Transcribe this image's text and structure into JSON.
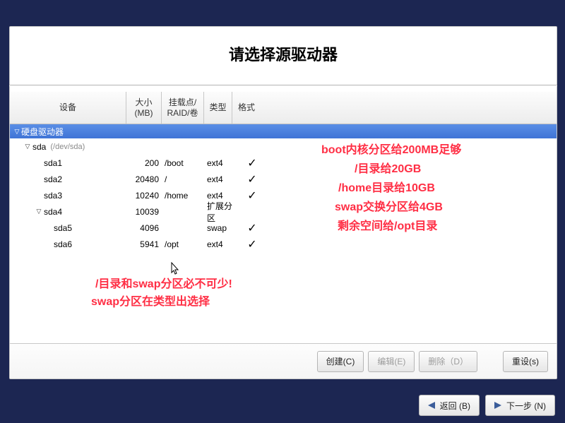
{
  "title": "请选择源驱动器",
  "headers": {
    "device": "设备",
    "size": "大小 (MB)",
    "mount": "挂载点/ RAID/卷",
    "type": "类型",
    "format": "格式"
  },
  "group_label": "硬盘驱动器",
  "disk": {
    "name": "sda",
    "path": "(/dev/sda)"
  },
  "rows": [
    {
      "indent": 48,
      "tri": "",
      "dev": "sda1",
      "size": "200",
      "mount": "/boot",
      "type": "ext4",
      "fmt": "✓"
    },
    {
      "indent": 48,
      "tri": "",
      "dev": "sda2",
      "size": "20480",
      "mount": "/",
      "type": "ext4",
      "fmt": "✓"
    },
    {
      "indent": 48,
      "tri": "",
      "dev": "sda3",
      "size": "10240",
      "mount": "/home",
      "type": "ext4",
      "fmt": "✓"
    },
    {
      "indent": 34,
      "tri": "▽",
      "dev": "sda4",
      "size": "10039",
      "mount": "",
      "type": "扩展分区",
      "fmt": ""
    },
    {
      "indent": 62,
      "tri": "",
      "dev": "sda5",
      "size": "4096",
      "mount": "",
      "type": "swap",
      "fmt": "✓"
    },
    {
      "indent": 62,
      "tri": "",
      "dev": "sda6",
      "size": "5941",
      "mount": "/opt",
      "type": "ext4",
      "fmt": "✓"
    }
  ],
  "buttons": {
    "create": "创建(C)",
    "edit": "编辑(E)",
    "delete": "删除（D）",
    "reset": "重设(s)",
    "back": "返回 (B)",
    "next": "下一步 (N)"
  },
  "annotations": {
    "r1": "boot内核分区给200MB足够",
    "r2": "/目录给20GB",
    "r3": "/home目录给10GB",
    "r4": "swap交换分区给4GB",
    "r5": "剩余空间给/opt目录",
    "b1": "/目录和swap分区必不可少!",
    "b2": "swap分区在类型出选择"
  }
}
